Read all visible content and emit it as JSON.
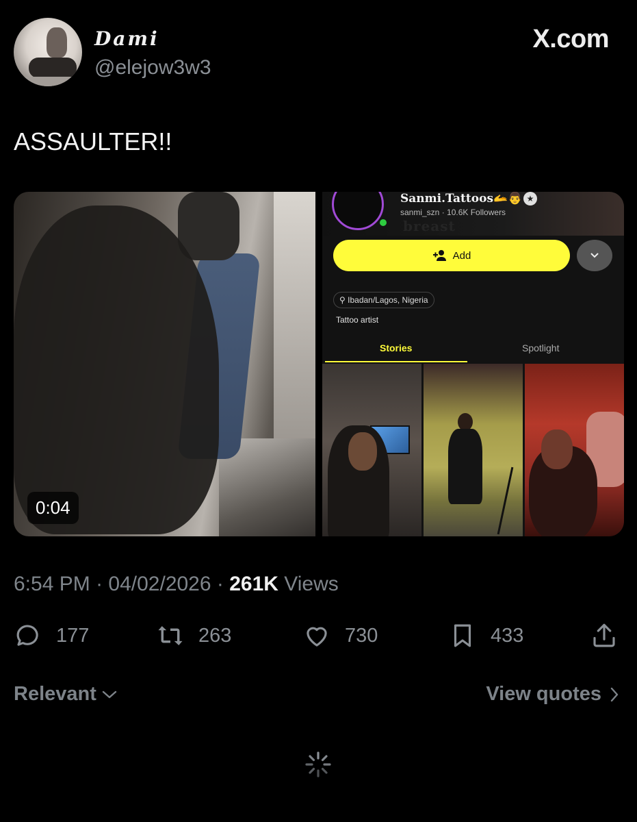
{
  "author": {
    "display_name": "Dami",
    "handle": "@elejow3w3"
  },
  "brand": "X.com",
  "tweet": {
    "text": "ASSAULTER!!"
  },
  "media": {
    "video_duration": "0:04",
    "profile_card": {
      "username": "Sanmi.Tattoos🫴👨",
      "meta": "sanmi_szn · 10.6K Followers",
      "sticker_text": "breast",
      "add_label": "Add",
      "location": "Ibadan/Lagos, Nigeria",
      "bio": "Tattoo artist",
      "tab_stories": "Stories",
      "tab_spotlight": "Spotlight"
    }
  },
  "meta": {
    "time": "6:54 PM",
    "date": "04/02/2026",
    "views_count": "261K",
    "views_label": "Views"
  },
  "actions": {
    "replies": "177",
    "reposts": "263",
    "likes": "730",
    "bookmarks": "433"
  },
  "footer": {
    "sort_label": "Relevant",
    "quotes_label": "View quotes"
  },
  "colors": {
    "background": "#000000",
    "snap_yellow": "#fffc3a",
    "muted_text": "#8b9096"
  },
  "icons": [
    "reply-icon",
    "repost-icon",
    "heart-icon",
    "bookmark-icon",
    "share-icon",
    "chevron-down-icon",
    "chevron-right-icon",
    "loading-spinner-icon"
  ]
}
